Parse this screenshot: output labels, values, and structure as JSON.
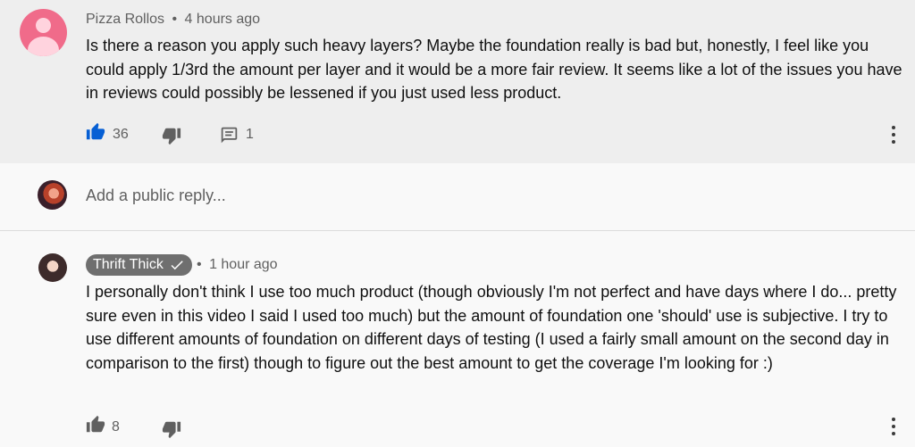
{
  "comment": {
    "author": "Pizza Rollos",
    "separator": "•",
    "time": "4 hours ago",
    "text": "Is there a reason you apply such heavy layers? Maybe the foundation really is bad but, honestly, I feel like you could apply 1/3rd the amount per layer and it would be a more fair review. It seems like a lot of the issues you have in reviews could possibly be lessened if you just used less product.",
    "likes": "36",
    "replies": "1",
    "like_color": "#065fd4"
  },
  "reply_box": {
    "placeholder": "Add a public reply..."
  },
  "reply": {
    "author": "Thrift Thick",
    "verified": true,
    "separator": "•",
    "time": "1 hour ago",
    "text": "I personally don't think I use too much product (though obviously I'm not perfect and have days where I do... pretty sure even in this video I said I used too much) but the amount of foundation one 'should' use is subjective. I try to use different amounts of foundation on different days of testing (I used a fairly small amount on the second day in comparison to the first) though to figure out the best amount to get the coverage I'm looking for :)",
    "likes": "8"
  },
  "icons": {
    "like": "thumbs-up-icon",
    "dislike": "thumbs-down-icon",
    "reply": "comment-icon",
    "more": "more-vert-icon",
    "verified": "checkmark-icon"
  }
}
